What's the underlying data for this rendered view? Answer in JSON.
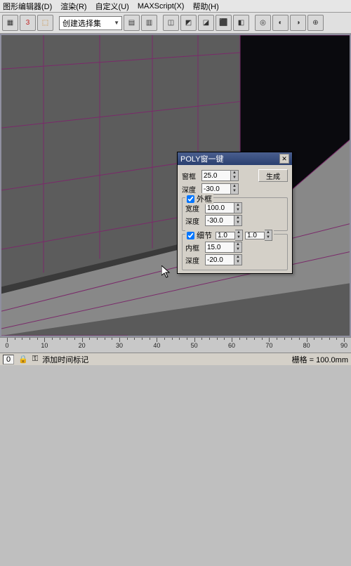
{
  "menu": {
    "items": [
      "图形编辑器(D)",
      "渲染(R)",
      "自定义(U)",
      "MAXScript(X)",
      "帮助(H)"
    ]
  },
  "toolbar": {
    "dropdown_label": "创建选择集",
    "icons": [
      "tool1",
      "tool2",
      "tool3",
      "tool4",
      "tool5",
      "tool6",
      "tool7",
      "tool8",
      "tool9",
      "tool10",
      "tool11",
      "tool12",
      "tool13",
      "tool14",
      "tool15"
    ]
  },
  "dialog": {
    "title": "POLY窗一键",
    "top": {
      "p1_label": "窗框",
      "p1_value": "25.0",
      "p2_label": "深度",
      "p2_value": "-30.0",
      "build_label": "生成"
    },
    "group1": {
      "chk_label": "外框",
      "p1_label": "宽度",
      "p1_value": "100.0",
      "p2_label": "深度",
      "p2_value": "-30.0"
    },
    "group2": {
      "chk_label": "细节",
      "g2b_value": "1.0",
      "g2c_value": "1.0",
      "p1_label": "内框",
      "p1_value": "15.0",
      "p2_label": "深度",
      "p2_value": "-20.0"
    }
  },
  "timeline": {
    "ticks": [
      0,
      10,
      20,
      30,
      40,
      50,
      60,
      70,
      80,
      90
    ]
  },
  "status": {
    "left": "0",
    "add_keyframe": "添加时间标记",
    "grid_label": "栅格 = 100.0mm"
  }
}
